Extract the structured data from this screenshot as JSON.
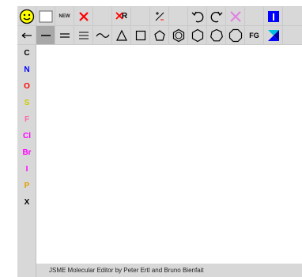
{
  "toolbar": {
    "new_label": "NEW",
    "delete_r_label": "R",
    "fg_label": "FG",
    "icons": [
      "smiley-icon",
      "blank-square-icon",
      "new-icon",
      "delete-icon",
      "delete-r-icon",
      "charge-icon",
      "undo-icon",
      "redo-icon",
      "clear-icon",
      "info-icon",
      "chain-icon",
      "single-bond-icon",
      "double-bond-icon",
      "triple-bond-icon",
      "chain-wave-icon",
      "triangle-ring-icon",
      "square-ring-icon",
      "pentagon-ring-icon",
      "benzene-ring-icon",
      "hexagon-ring-icon",
      "heptagon-ring-icon",
      "fg-icon",
      "jsme-logo-icon"
    ]
  },
  "atoms": [
    {
      "symbol": "C",
      "color": "#000000"
    },
    {
      "symbol": "N",
      "color": "#0000ff"
    },
    {
      "symbol": "O",
      "color": "#ff0000"
    },
    {
      "symbol": "S",
      "color": "#cccc00"
    },
    {
      "symbol": "F",
      "color": "#ff66aa"
    },
    {
      "symbol": "Cl",
      "color": "#ff00ff"
    },
    {
      "symbol": "Br",
      "color": "#ff00ff"
    },
    {
      "symbol": "I",
      "color": "#ff00ff"
    },
    {
      "symbol": "P",
      "color": "#e0a000"
    },
    {
      "symbol": "X",
      "color": "#000000"
    }
  ],
  "status": {
    "text": "JSME Molecular Editor by Peter Ertl and Bruno Bienfait"
  },
  "colors": {
    "toolbar_bg": "#d8d8d8",
    "accent_blue": "#0000ff",
    "delete_red": "#ff0000",
    "smiley_yellow": "#ffff00"
  }
}
